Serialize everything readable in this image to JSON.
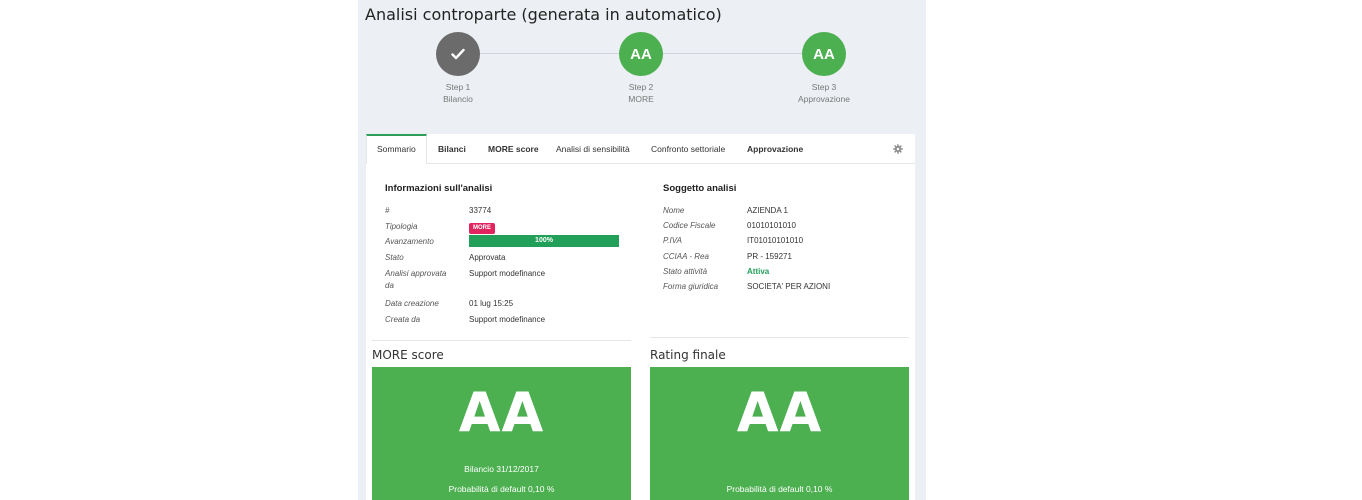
{
  "page_title": "Analisi controparte (generata in automatico)",
  "steps": [
    {
      "icon": "check-icon",
      "circle_text": "",
      "number": "Step 1",
      "name": "Bilancio"
    },
    {
      "circle_text": "AA",
      "number": "Step 2",
      "name": "MORE"
    },
    {
      "circle_text": "AA",
      "number": "Step 3",
      "name": "Approvazione"
    }
  ],
  "tabs": [
    "Sommario",
    "Bilanci",
    "MORE score",
    "Analisi di sensibilità",
    "Confronto settoriale",
    "Approvazione"
  ],
  "info": {
    "title": "Informazioni sull'analisi",
    "id_label": "#",
    "id_value": "33774",
    "tipologia_label": "Tipologia",
    "tipologia_badge": "MORE",
    "avanzamento_label": "Avanzamento",
    "avanzamento_value": "100%",
    "avanzamento_fraction": 1.0,
    "stato_label": "Stato",
    "stato_value": "Approvata",
    "approvata_label_1": "Analisi approvata",
    "approvata_label_2": "da",
    "approvata_value": "Support modefinance",
    "data_label": "Data creazione",
    "data_value": "01 lug 15:25",
    "creata_label": "Creata da",
    "creata_value": "Support modefinance"
  },
  "subject": {
    "title": "Soggetto analisi",
    "nome_label": "Nome",
    "nome_value": "AZIENDA 1",
    "cf_label": "Codice Fiscale",
    "cf_value": "01010101010",
    "piva_label": "P.IVA",
    "piva_value": "IT01010101010",
    "cciaa_label": "CCIAA - Rea",
    "cciaa_value": "PR - 159271",
    "stato_label": "Stato attività",
    "stato_value": "Attiva",
    "forma_label": "Forma giuridica",
    "forma_value": "SOCIETA' PER AZIONI"
  },
  "more_score": {
    "title": "MORE score",
    "rating": "AA",
    "bilancio": "Bilancio 31/12/2017",
    "probabilita": "Probabilità di default 0,10 %"
  },
  "rating_finale": {
    "title": "Rating finale",
    "rating": "AA",
    "probabilita": "Probabilità di default 0,10 %"
  },
  "colors": {
    "accent_green": "#4caf50",
    "progress_green": "#22a05a",
    "badge_pink": "#e0245e",
    "step_done_gray": "#6b6b6b"
  }
}
